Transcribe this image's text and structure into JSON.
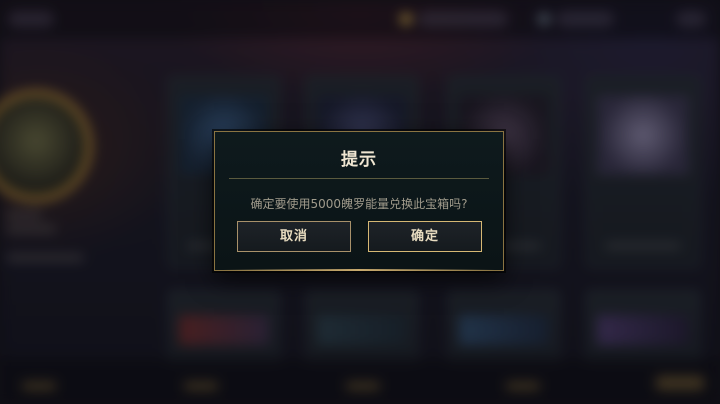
{
  "dialog": {
    "title": "提示",
    "message": "确定要使用5000魄罗能量兑换此宝箱吗?",
    "cancel_label": "取消",
    "confirm_label": "确定"
  },
  "colors": {
    "accent_gold": "#c8aa6e",
    "dialog_background": "#0e1a1d",
    "title_text": "#f0e6d2",
    "message_text": "#a09b8c"
  }
}
